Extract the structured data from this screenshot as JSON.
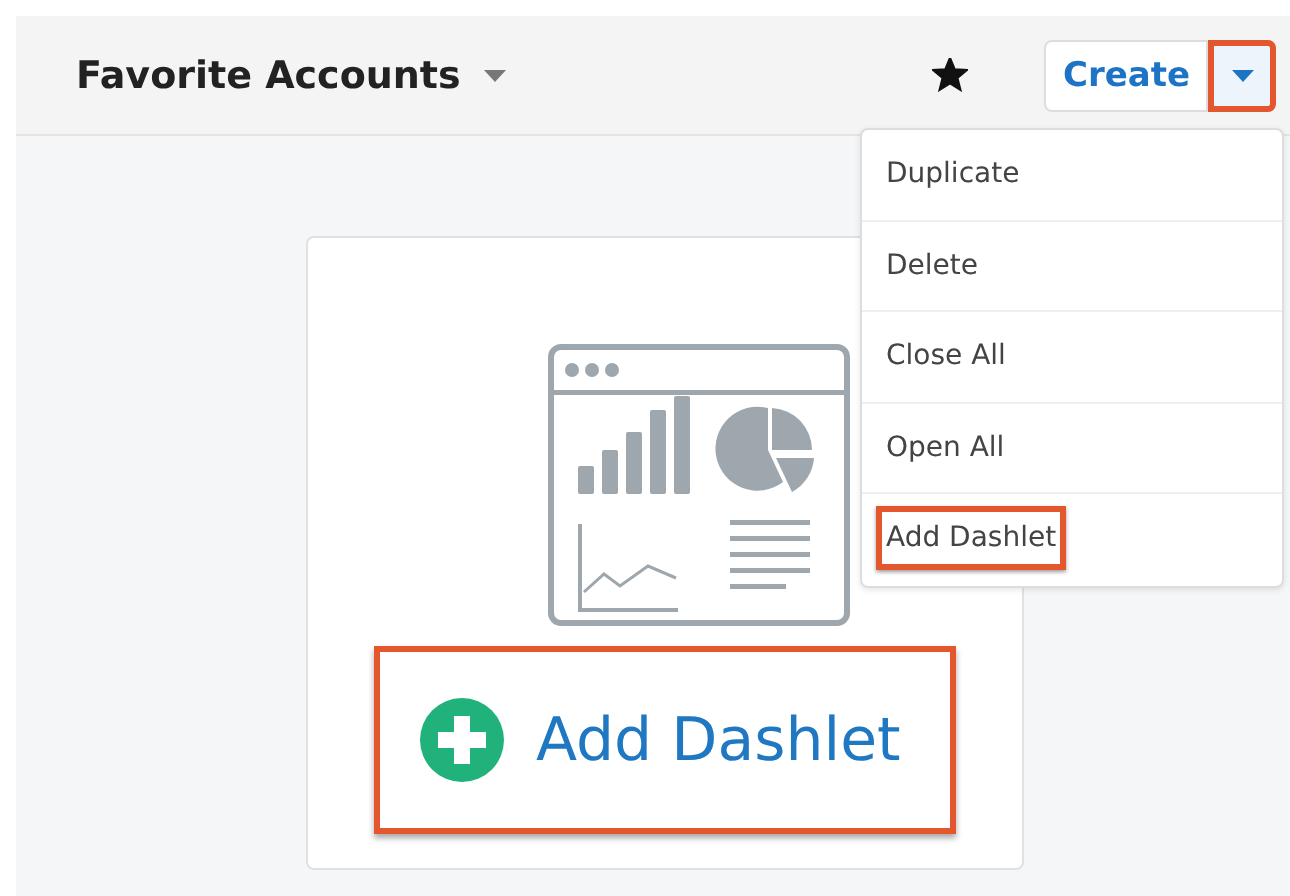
{
  "header": {
    "title": "Favorite Accounts",
    "favorite": true,
    "create_button": {
      "label": "Create"
    },
    "actions_toggle": {
      "expanded": true,
      "highlighted": true
    }
  },
  "actions_menu": [
    {
      "label": "Duplicate",
      "highlighted": false
    },
    {
      "label": "Delete",
      "highlighted": false
    },
    {
      "label": "Close All",
      "highlighted": false
    },
    {
      "label": "Open All",
      "highlighted": false
    },
    {
      "label": "Add Dashlet",
      "highlighted": true
    }
  ],
  "dashlet_placeholder": {
    "button": {
      "label": "Add Dashlet",
      "highlighted": true
    }
  }
}
